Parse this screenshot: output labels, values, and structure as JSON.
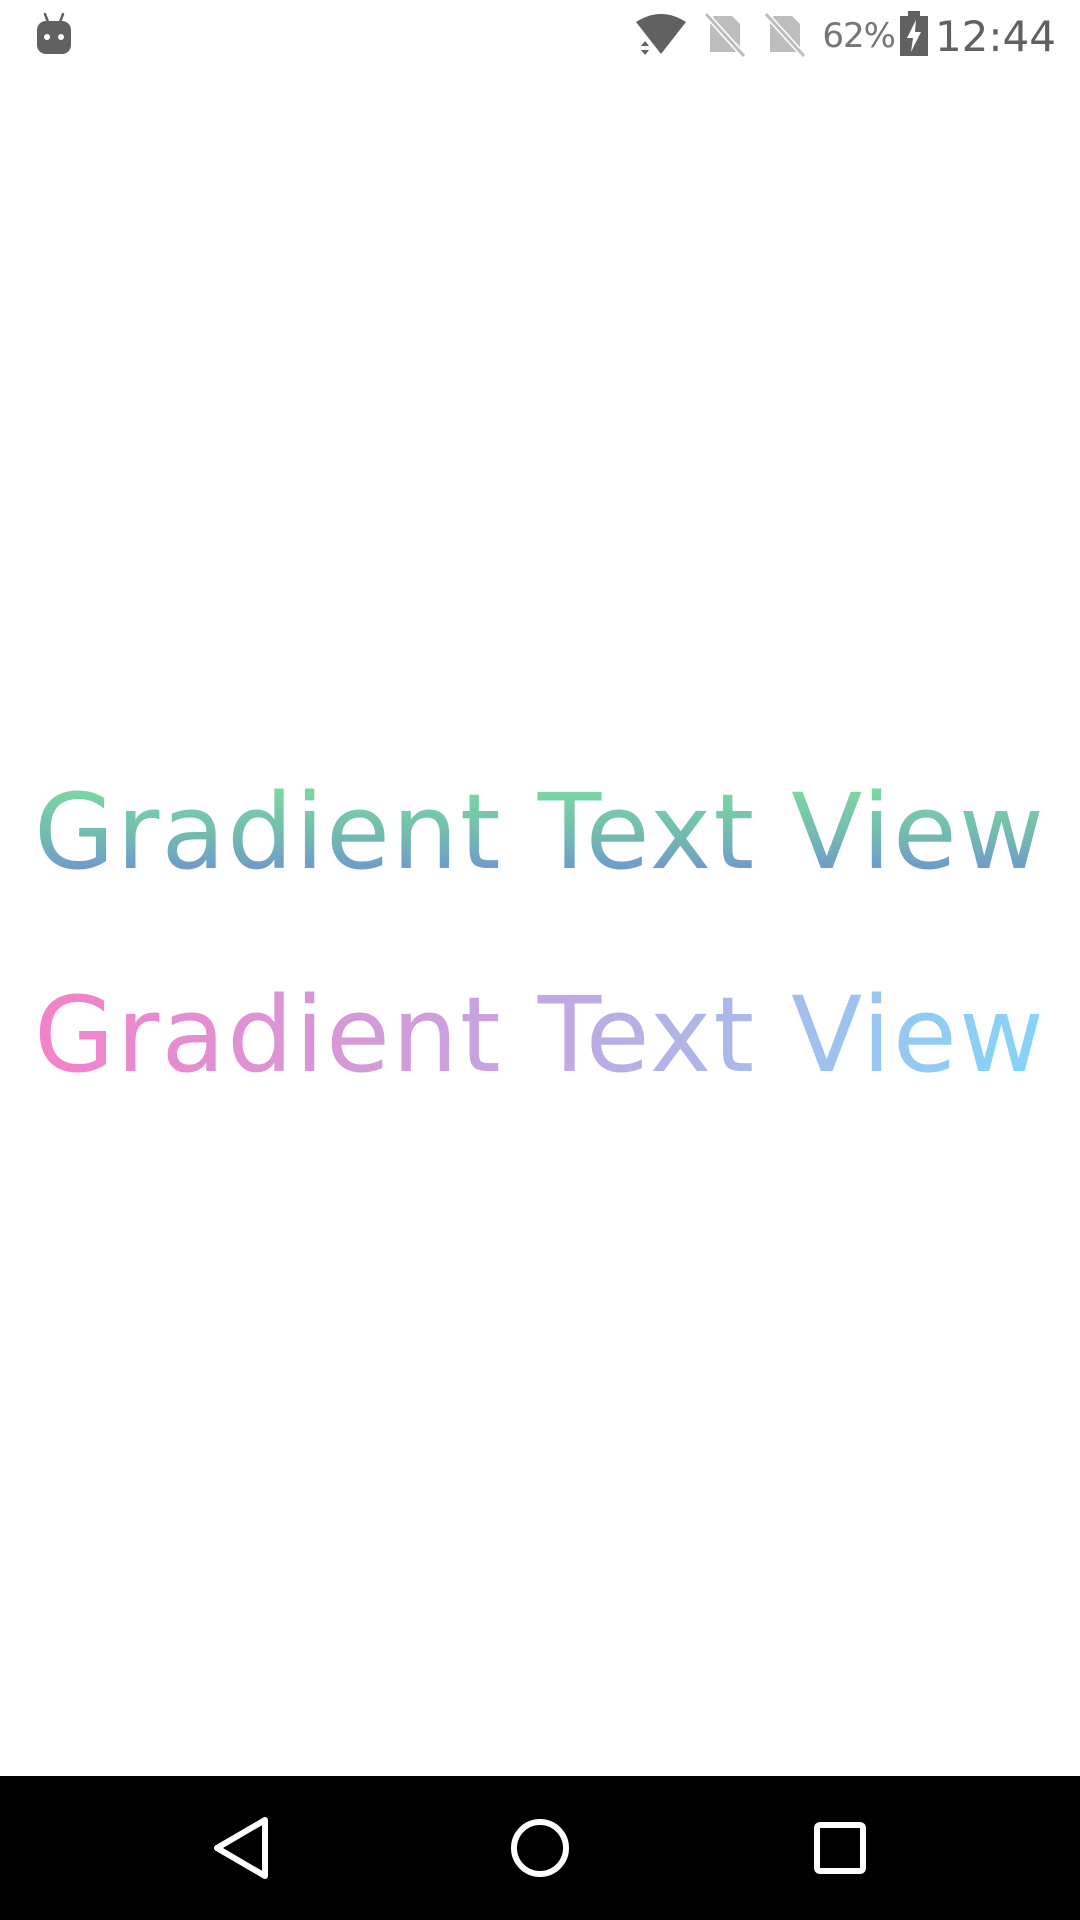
{
  "status_bar": {
    "battery_percent": "62%",
    "time": "12:44",
    "icons": [
      "android-debug-icon",
      "wifi-icon",
      "no-sim-icon",
      "no-sim-icon",
      "battery-charging-icon"
    ]
  },
  "content": {
    "gradient_text_1": "Gradient Text View",
    "gradient_text_2": "Gradient Text View",
    "colors": {
      "text1_gradient": [
        "#7ee39c",
        "#72b8b2",
        "#6f84dd"
      ],
      "text2_gradient": [
        "#f77fc8",
        "#c3a7e0",
        "#7fd8fb"
      ]
    }
  },
  "nav_bar": {
    "icons": [
      "back-icon",
      "home-icon",
      "recents-icon"
    ]
  }
}
